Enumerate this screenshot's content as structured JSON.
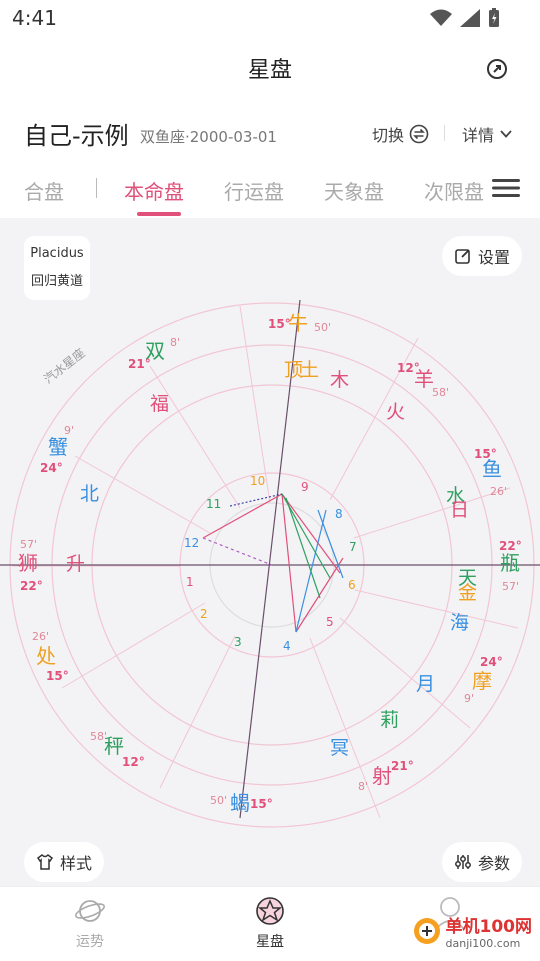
{
  "status": {
    "time": "4:41"
  },
  "header": {
    "title": "星盘"
  },
  "profile": {
    "name": "自己-示例",
    "sub": "双鱼座·2000-03-01",
    "switch_label": "切换",
    "detail_label": "详情"
  },
  "tabs": [
    {
      "label": "合盘"
    },
    {
      "label": "本命盘"
    },
    {
      "label": "行运盘"
    },
    {
      "label": "天象盘"
    },
    {
      "label": "次限盘"
    }
  ],
  "chart_badge": {
    "system": "Placidus",
    "zodiac": "回归黄道"
  },
  "settings_label": "设置",
  "style_label": "样式",
  "params_label": "参数",
  "ring_label": "汽水星座",
  "nav": [
    {
      "label": "运势"
    },
    {
      "label": "星盘"
    }
  ],
  "watermark": {
    "text": "单机100网",
    "url": "danji100.com"
  },
  "colors": {
    "accent": "#e0507a",
    "fire": "#e0507a",
    "earth": "#f0a020",
    "air": "#30a060",
    "water": "#3a90e0"
  }
}
